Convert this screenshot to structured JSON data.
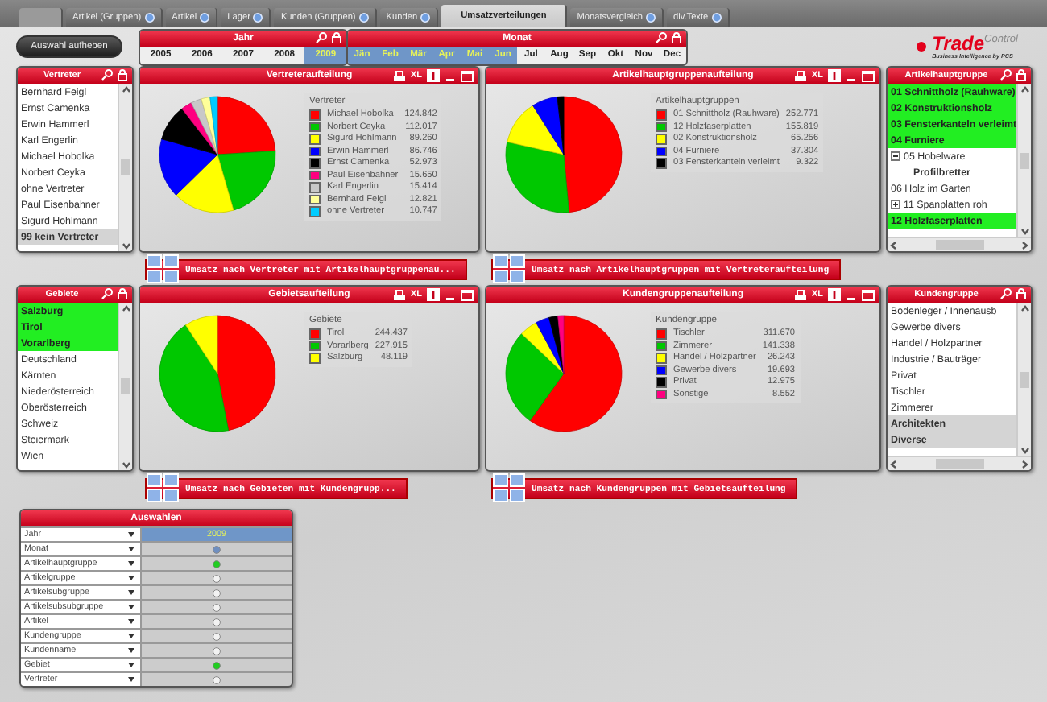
{
  "tabs": [
    {
      "label": "Artikel (Gruppen)",
      "selected": false
    },
    {
      "label": "Artikel",
      "selected": false
    },
    {
      "label": "Lager",
      "selected": false
    },
    {
      "label": "Kunden (Gruppen)",
      "selected": false
    },
    {
      "label": "Kunden",
      "selected": false
    },
    {
      "label": "Umsatzverteilungen",
      "selected": true
    },
    {
      "label": "Monatsvergleich",
      "selected": false
    },
    {
      "label": "div.Texte",
      "selected": false
    }
  ],
  "clear_button": "Auswahl aufheben",
  "year_box": {
    "title": "Jahr",
    "values": [
      {
        "label": "2005",
        "selected": false
      },
      {
        "label": "2006",
        "selected": false
      },
      {
        "label": "2007",
        "selected": false
      },
      {
        "label": "2008",
        "selected": false
      },
      {
        "label": "2009",
        "selected": true
      }
    ]
  },
  "month_box": {
    "title": "Monat",
    "values": [
      {
        "label": "Jän",
        "selected": true
      },
      {
        "label": "Feb",
        "selected": true
      },
      {
        "label": "Mär",
        "selected": true
      },
      {
        "label": "Apr",
        "selected": true
      },
      {
        "label": "Mai",
        "selected": true
      },
      {
        "label": "Jun",
        "selected": true
      },
      {
        "label": "Jul",
        "selected": false
      },
      {
        "label": "Aug",
        "selected": false
      },
      {
        "label": "Sep",
        "selected": false
      },
      {
        "label": "Okt",
        "selected": false
      },
      {
        "label": "Nov",
        "selected": false
      },
      {
        "label": "Dec",
        "selected": false
      }
    ]
  },
  "logo": {
    "name": "Trade",
    "superscript": "Control",
    "tagline": "Business Intelligence by PCS"
  },
  "sections": [
    {
      "left_list": {
        "title": "Vertreter",
        "items": [
          {
            "label": "Bernhard Feigl",
            "selected": false,
            "excluded": false
          },
          {
            "label": "Ernst Camenka",
            "selected": false,
            "excluded": false
          },
          {
            "label": "Erwin Hammerl",
            "selected": false,
            "excluded": false
          },
          {
            "label": "Karl Engerlin",
            "selected": false,
            "excluded": false
          },
          {
            "label": "Michael Hobolka",
            "selected": false,
            "excluded": false
          },
          {
            "label": "Norbert Ceyka",
            "selected": false,
            "excluded": false
          },
          {
            "label": "ohne Vertreter",
            "selected": false,
            "excluded": false
          },
          {
            "label": "Paul Eisenbahner",
            "selected": false,
            "excluded": false
          },
          {
            "label": "Sigurd Hohlmann",
            "selected": false,
            "excluded": false
          },
          {
            "label": "99 kein Vertreter",
            "selected": false,
            "excluded": true
          }
        ]
      },
      "charts": [
        {
          "xl_label": "XL",
          "link_button": "Umsatz nach Vertreter mit Artikelhauptgruppenau...",
          "chart_data": {
            "type": "pie",
            "title": "Vertreteraufteilung",
            "xlabel": "Vertreter",
            "categories": [
              "Michael Hobolka",
              "Norbert Ceyka",
              "Sigurd Hohlmann",
              "Erwin Hammerl",
              "Ernst Camenka",
              "Paul Eisenbahner",
              "Karl Engerlin",
              "Bernhard Feigl",
              "ohne Vertreter"
            ],
            "colors": [
              "#ff0000",
              "#00c800",
              "#ffff00",
              "#0000ff",
              "#000000",
              "#ff0080",
              "#c8c8c8",
              "#ffff99",
              "#00ccff"
            ],
            "values": [
              23.99,
              21.52,
              17.15,
              16.67,
              10.18,
              3.01,
              2.96,
              2.46,
              2.06
            ]
          },
          "legend_values": [
            "124.842",
            "112.017",
            "89.260",
            "86.746",
            "52.973",
            "15.650",
            "15.414",
            "12.821",
            "10.747"
          ]
        },
        {
          "xl_label": "XL",
          "link_button": "Umsatz nach Artikelhauptgruppen mit Vertreteraufteilung",
          "chart_data": {
            "type": "pie",
            "title": "Artikelhauptgruppenaufteilung",
            "xlabel": "Artikelhauptgruppen",
            "categories": [
              "01 Schnittholz (Rauhware)",
              "12 Holzfaserplatten",
              "02 Konstruktionsholz",
              "04 Furniere",
              "03 Fensterkanteln verleimt"
            ],
            "colors": [
              "#ff0000",
              "#00c800",
              "#ffff00",
              "#0000ff",
              "#000000"
            ],
            "values": [
              48.56,
              29.94,
              12.54,
              7.17,
              1.79
            ]
          },
          "legend_values": [
            "252.771",
            "155.819",
            "65.256",
            "37.304",
            "9.322"
          ]
        }
      ],
      "right_list": {
        "title": "Artikelhauptgruppe",
        "items": [
          {
            "label": "01 Schnittholz (Rauhware)",
            "selected": true,
            "excluded": false
          },
          {
            "label": "02 Konstruktionsholz",
            "selected": true,
            "excluded": false
          },
          {
            "label": "03 Fensterkanteln verleimt",
            "selected": true,
            "excluded": false
          },
          {
            "label": "04 Furniere",
            "selected": true,
            "excluded": false
          },
          {
            "label": "05 Hobelware",
            "selected": false,
            "excluded": false,
            "expanded": true,
            "children": [
              {
                "label": "Profilbretter",
                "selected": false,
                "excluded": false
              }
            ]
          },
          {
            "label": "06 Holz im Garten",
            "selected": false,
            "excluded": false
          },
          {
            "label": "11 Spanplatten roh",
            "selected": false,
            "excluded": false,
            "expanded": false
          },
          {
            "label": "12 Holzfaserplatten",
            "selected": true,
            "excluded": false
          }
        ]
      }
    },
    {
      "left_list": {
        "title": "Gebiete",
        "items": [
          {
            "label": "Salzburg",
            "selected": true,
            "excluded": false
          },
          {
            "label": "Tirol",
            "selected": true,
            "excluded": false
          },
          {
            "label": "Vorarlberg",
            "selected": true,
            "excluded": false
          },
          {
            "label": "Deutschland",
            "selected": false,
            "excluded": false
          },
          {
            "label": "Kärnten",
            "selected": false,
            "excluded": false
          },
          {
            "label": "Niederösterreich",
            "selected": false,
            "excluded": false
          },
          {
            "label": "Oberösterreich",
            "selected": false,
            "excluded": false
          },
          {
            "label": "Schweiz",
            "selected": false,
            "excluded": false
          },
          {
            "label": "Steiermark",
            "selected": false,
            "excluded": false
          },
          {
            "label": "Wien",
            "selected": false,
            "excluded": false
          }
        ]
      },
      "charts": [
        {
          "xl_label": "XL",
          "link_button": "Umsatz nach Gebieten mit Kundengrupp...",
          "chart_data": {
            "type": "pie",
            "title": "Gebietsaufteilung",
            "xlabel": "Gebiete",
            "categories": [
              "Tirol",
              "Vorarlberg",
              "Salzburg"
            ],
            "colors": [
              "#ff0000",
              "#00c800",
              "#ffff00"
            ],
            "values": [
              46.96,
              43.79,
              9.25
            ]
          },
          "legend_values": [
            "244.437",
            "227.915",
            "48.119"
          ]
        },
        {
          "xl_label": "XL",
          "link_button": "Umsatz nach Kundengruppen mit Gebietsaufteilung",
          "chart_data": {
            "type": "pie",
            "title": "Kundengruppenaufteilung",
            "xlabel": "Kundengruppe",
            "categories": [
              "Tischler",
              "Zimmerer",
              "Handel / Holzpartner",
              "Gewerbe divers",
              "Privat",
              "Sonstige"
            ],
            "colors": [
              "#ff0000",
              "#00c800",
              "#ffff00",
              "#0000ff",
              "#000000",
              "#ff0080"
            ],
            "values": [
              59.89,
              27.16,
              5.04,
              3.78,
              2.49,
              1.64
            ]
          },
          "legend_values": [
            "311.670",
            "141.338",
            "26.243",
            "19.693",
            "12.975",
            "8.552"
          ]
        }
      ],
      "right_list": {
        "title": "Kundengruppe",
        "items": [
          {
            "label": "Bodenleger / Innenausb",
            "selected": false,
            "excluded": false
          },
          {
            "label": "Gewerbe divers",
            "selected": false,
            "excluded": false
          },
          {
            "label": "Handel / Holzpartner",
            "selected": false,
            "excluded": false
          },
          {
            "label": "Industrie / Bauträger",
            "selected": false,
            "excluded": false
          },
          {
            "label": "Privat",
            "selected": false,
            "excluded": false
          },
          {
            "label": "Tischler",
            "selected": false,
            "excluded": false
          },
          {
            "label": "Zimmerer",
            "selected": false,
            "excluded": false
          },
          {
            "label": "Architekten",
            "selected": false,
            "excluded": true
          },
          {
            "label": "Diverse",
            "selected": false,
            "excluded": true
          }
        ]
      }
    }
  ],
  "selections_table": {
    "title": "Auswahlen",
    "rows": [
      {
        "field": "Jahr",
        "kind": "value",
        "value": "2009"
      },
      {
        "field": "Monat",
        "kind": "dot",
        "color": "#6f8fc0"
      },
      {
        "field": "Artikelhauptgruppe",
        "kind": "dot",
        "color": "#22cc22"
      },
      {
        "field": "Artikelgruppe",
        "kind": "dot",
        "color": "#f2f2f2"
      },
      {
        "field": "Artikelsubgruppe",
        "kind": "dot",
        "color": "#f2f2f2"
      },
      {
        "field": "Artikelsubsubgruppe",
        "kind": "dot",
        "color": "#f2f2f2"
      },
      {
        "field": "Artikel",
        "kind": "dot",
        "color": "#f2f2f2"
      },
      {
        "field": "Kundengruppe",
        "kind": "dot",
        "color": "#f2f2f2"
      },
      {
        "field": "Kundenname",
        "kind": "dot",
        "color": "#f2f2f2"
      },
      {
        "field": "Gebiet",
        "kind": "dot",
        "color": "#22cc22"
      },
      {
        "field": "Vertreter",
        "kind": "dot",
        "color": "#f2f2f2"
      }
    ]
  }
}
